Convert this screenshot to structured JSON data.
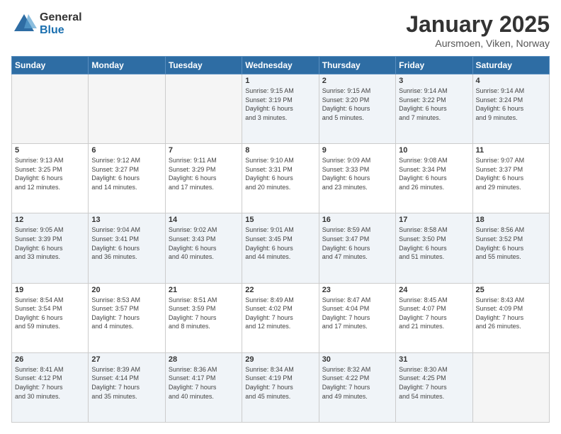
{
  "logo": {
    "general": "General",
    "blue": "Blue"
  },
  "title": "January 2025",
  "location": "Aursmoen, Viken, Norway",
  "days_of_week": [
    "Sunday",
    "Monday",
    "Tuesday",
    "Wednesday",
    "Thursday",
    "Friday",
    "Saturday"
  ],
  "weeks": [
    [
      {
        "day": null,
        "info": null
      },
      {
        "day": null,
        "info": null
      },
      {
        "day": null,
        "info": null
      },
      {
        "day": "1",
        "info": "Sunrise: 9:15 AM\nSunset: 3:19 PM\nDaylight: 6 hours\nand 3 minutes."
      },
      {
        "day": "2",
        "info": "Sunrise: 9:15 AM\nSunset: 3:20 PM\nDaylight: 6 hours\nand 5 minutes."
      },
      {
        "day": "3",
        "info": "Sunrise: 9:14 AM\nSunset: 3:22 PM\nDaylight: 6 hours\nand 7 minutes."
      },
      {
        "day": "4",
        "info": "Sunrise: 9:14 AM\nSunset: 3:24 PM\nDaylight: 6 hours\nand 9 minutes."
      }
    ],
    [
      {
        "day": "5",
        "info": "Sunrise: 9:13 AM\nSunset: 3:25 PM\nDaylight: 6 hours\nand 12 minutes."
      },
      {
        "day": "6",
        "info": "Sunrise: 9:12 AM\nSunset: 3:27 PM\nDaylight: 6 hours\nand 14 minutes."
      },
      {
        "day": "7",
        "info": "Sunrise: 9:11 AM\nSunset: 3:29 PM\nDaylight: 6 hours\nand 17 minutes."
      },
      {
        "day": "8",
        "info": "Sunrise: 9:10 AM\nSunset: 3:31 PM\nDaylight: 6 hours\nand 20 minutes."
      },
      {
        "day": "9",
        "info": "Sunrise: 9:09 AM\nSunset: 3:33 PM\nDaylight: 6 hours\nand 23 minutes."
      },
      {
        "day": "10",
        "info": "Sunrise: 9:08 AM\nSunset: 3:34 PM\nDaylight: 6 hours\nand 26 minutes."
      },
      {
        "day": "11",
        "info": "Sunrise: 9:07 AM\nSunset: 3:37 PM\nDaylight: 6 hours\nand 29 minutes."
      }
    ],
    [
      {
        "day": "12",
        "info": "Sunrise: 9:05 AM\nSunset: 3:39 PM\nDaylight: 6 hours\nand 33 minutes."
      },
      {
        "day": "13",
        "info": "Sunrise: 9:04 AM\nSunset: 3:41 PM\nDaylight: 6 hours\nand 36 minutes."
      },
      {
        "day": "14",
        "info": "Sunrise: 9:02 AM\nSunset: 3:43 PM\nDaylight: 6 hours\nand 40 minutes."
      },
      {
        "day": "15",
        "info": "Sunrise: 9:01 AM\nSunset: 3:45 PM\nDaylight: 6 hours\nand 44 minutes."
      },
      {
        "day": "16",
        "info": "Sunrise: 8:59 AM\nSunset: 3:47 PM\nDaylight: 6 hours\nand 47 minutes."
      },
      {
        "day": "17",
        "info": "Sunrise: 8:58 AM\nSunset: 3:50 PM\nDaylight: 6 hours\nand 51 minutes."
      },
      {
        "day": "18",
        "info": "Sunrise: 8:56 AM\nSunset: 3:52 PM\nDaylight: 6 hours\nand 55 minutes."
      }
    ],
    [
      {
        "day": "19",
        "info": "Sunrise: 8:54 AM\nSunset: 3:54 PM\nDaylight: 6 hours\nand 59 minutes."
      },
      {
        "day": "20",
        "info": "Sunrise: 8:53 AM\nSunset: 3:57 PM\nDaylight: 7 hours\nand 4 minutes."
      },
      {
        "day": "21",
        "info": "Sunrise: 8:51 AM\nSunset: 3:59 PM\nDaylight: 7 hours\nand 8 minutes."
      },
      {
        "day": "22",
        "info": "Sunrise: 8:49 AM\nSunset: 4:02 PM\nDaylight: 7 hours\nand 12 minutes."
      },
      {
        "day": "23",
        "info": "Sunrise: 8:47 AM\nSunset: 4:04 PM\nDaylight: 7 hours\nand 17 minutes."
      },
      {
        "day": "24",
        "info": "Sunrise: 8:45 AM\nSunset: 4:07 PM\nDaylight: 7 hours\nand 21 minutes."
      },
      {
        "day": "25",
        "info": "Sunrise: 8:43 AM\nSunset: 4:09 PM\nDaylight: 7 hours\nand 26 minutes."
      }
    ],
    [
      {
        "day": "26",
        "info": "Sunrise: 8:41 AM\nSunset: 4:12 PM\nDaylight: 7 hours\nand 30 minutes."
      },
      {
        "day": "27",
        "info": "Sunrise: 8:39 AM\nSunset: 4:14 PM\nDaylight: 7 hours\nand 35 minutes."
      },
      {
        "day": "28",
        "info": "Sunrise: 8:36 AM\nSunset: 4:17 PM\nDaylight: 7 hours\nand 40 minutes."
      },
      {
        "day": "29",
        "info": "Sunrise: 8:34 AM\nSunset: 4:19 PM\nDaylight: 7 hours\nand 45 minutes."
      },
      {
        "day": "30",
        "info": "Sunrise: 8:32 AM\nSunset: 4:22 PM\nDaylight: 7 hours\nand 49 minutes."
      },
      {
        "day": "31",
        "info": "Sunrise: 8:30 AM\nSunset: 4:25 PM\nDaylight: 7 hours\nand 54 minutes."
      },
      {
        "day": null,
        "info": null
      }
    ]
  ]
}
